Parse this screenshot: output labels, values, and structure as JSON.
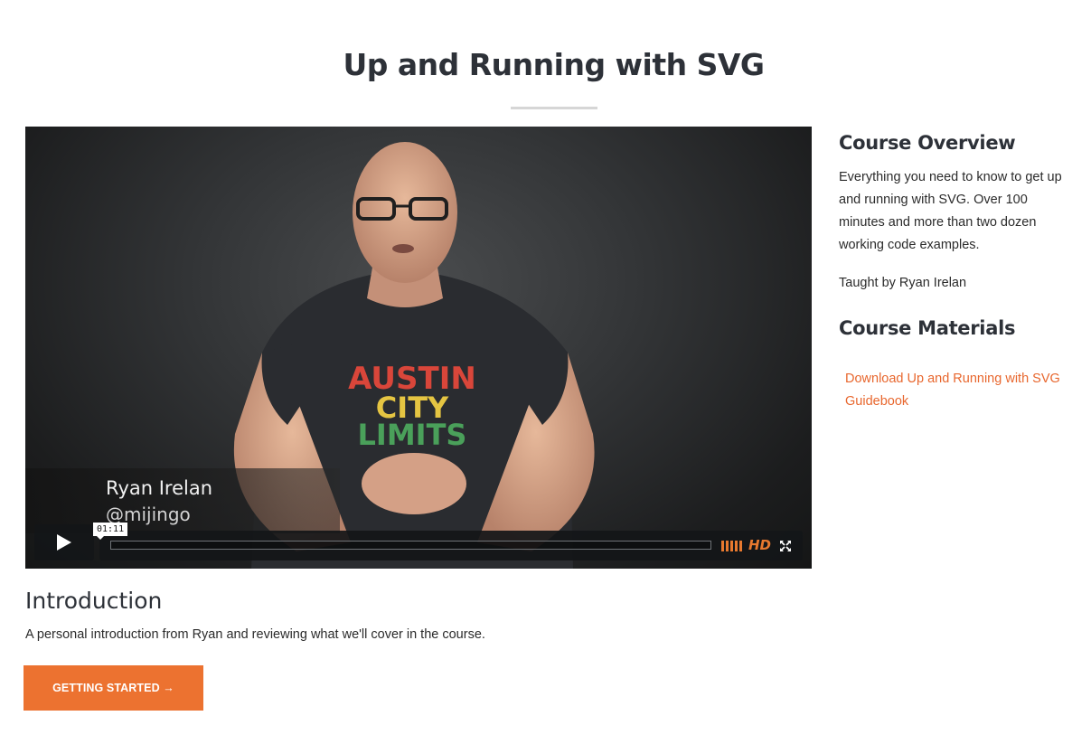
{
  "page": {
    "title": "Up and Running with SVG"
  },
  "video": {
    "lower_third_name": "Ryan Irelan",
    "lower_third_handle": "@mijingo",
    "shirt_text": [
      "AUSTIN",
      "CITY",
      "LIMITS"
    ],
    "time_tooltip": "01:11",
    "hd_label": "HD",
    "accent_color": "#e8792f",
    "icons": [
      "play-icon",
      "volume-icon",
      "fullscreen-icon"
    ]
  },
  "sidebar": {
    "overview_title": "Course Overview",
    "overview_text": "Everything you need to know to get up and running with SVG. Over 100 minutes and more than two dozen working code examples.",
    "taught_by": "Taught by Ryan Irelan",
    "materials_title": "Course Materials",
    "guidebook_link": "Download Up and Running with SVG Guidebook",
    "link_color": "#e8672e"
  },
  "lesson": {
    "title": "Introduction",
    "description": "A personal introduction from Ryan and reviewing what we'll cover in the course.",
    "cta_label": "GETTING STARTED →",
    "cta_color": "#ec7230"
  }
}
